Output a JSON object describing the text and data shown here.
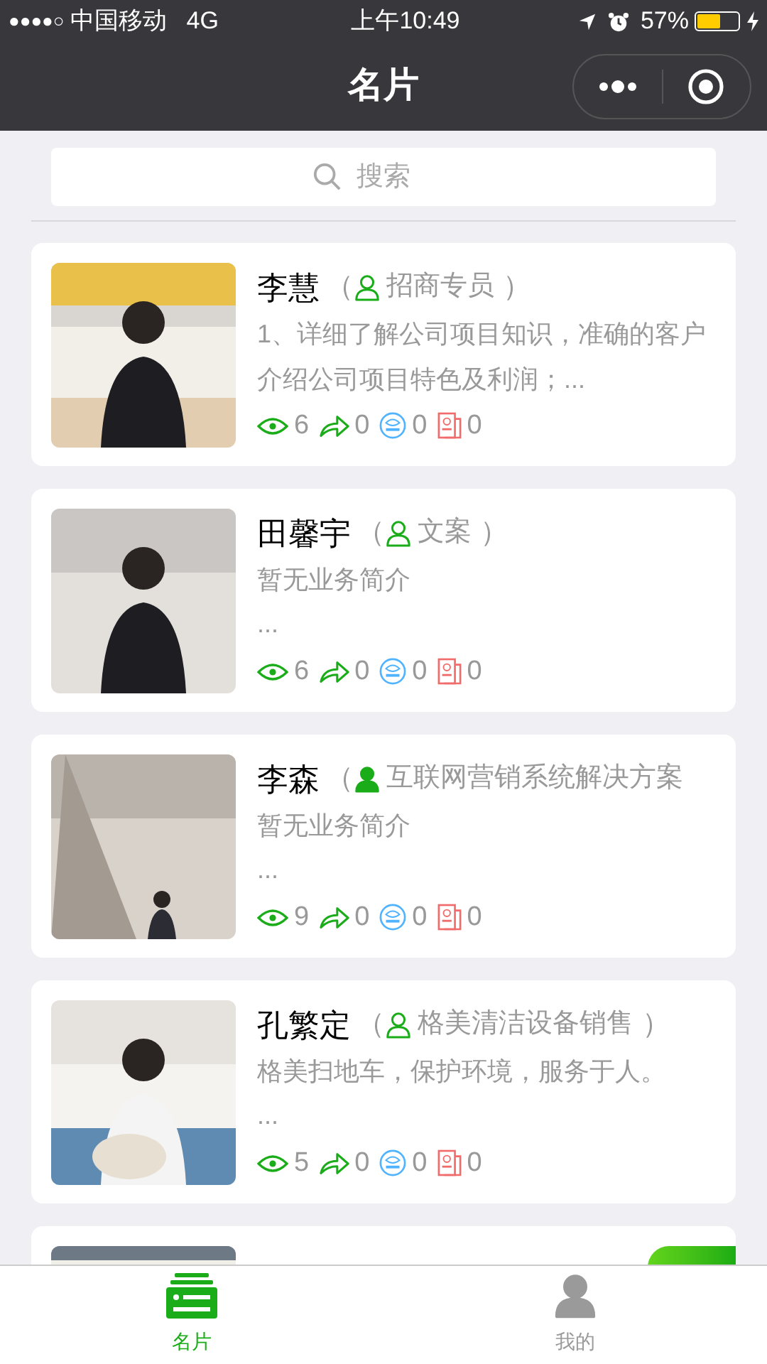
{
  "status_bar": {
    "signal": "●●●●○",
    "carrier": "中国移动",
    "network": "4G",
    "time": "上午10:49",
    "battery_text": "57%",
    "battery": {
      "level": 0.57
    }
  },
  "nav": {
    "title": "名片"
  },
  "search": {
    "placeholder": "搜索"
  },
  "cards": [
    {
      "kind": "full",
      "name": "李慧",
      "open": "（",
      "role": "招商专员",
      "close": "）",
      "role_icon_filled": false,
      "desc": "1、详细了解公司项目知识，准确的客户介绍公司项目特色及利润；...",
      "views": "6",
      "shares": "0",
      "news": "0",
      "docs": "0"
    },
    {
      "kind": "full",
      "name": "田馨宇",
      "open": "（",
      "role": "文案",
      "close": "）",
      "role_icon_filled": false,
      "desc": "暂无业务简介",
      "more": "...",
      "views": "6",
      "shares": "0",
      "news": "0",
      "docs": "0"
    },
    {
      "kind": "full",
      "name": "李森",
      "open": "（",
      "role": "互联网营销系统解决方案",
      "role_icon_filled": true,
      "desc": "暂无业务简介",
      "more": "...",
      "views": "9",
      "shares": "0",
      "news": "0",
      "docs": "0"
    },
    {
      "kind": "full",
      "name": "孔繁定",
      "open": "（",
      "role": "格美清洁设备销售",
      "close": "）",
      "role_icon_filled": false,
      "desc": "格美扫地车，保护环境，服务于人。",
      "more": "...",
      "views": "5",
      "shares": "0",
      "news": "0",
      "docs": "0"
    },
    {
      "kind": "peek"
    }
  ],
  "tabs": [
    {
      "label": "名片",
      "kind": "card",
      "selected": true
    },
    {
      "label": "我的",
      "kind": "user",
      "selected": false
    }
  ]
}
